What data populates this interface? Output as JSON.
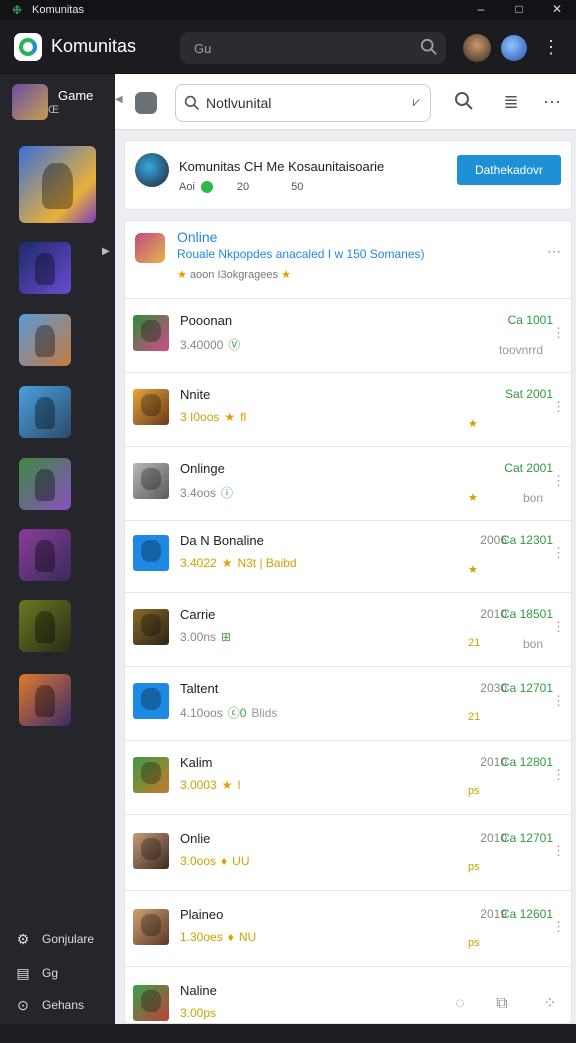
{
  "window": {
    "title": "Komunitas",
    "controls": [
      "–",
      "□",
      "✕"
    ]
  },
  "header": {
    "app_name": "Komunitas",
    "search_value": "Gu"
  },
  "sidebar": {
    "game": {
      "label": "Game",
      "sub": "Œ"
    },
    "bottom": [
      {
        "label": "Gonjulare",
        "icon": "gear-icon"
      },
      {
        "label": "Gg",
        "icon": "document-icon"
      },
      {
        "label": "Gehans",
        "icon": "compass-icon"
      }
    ]
  },
  "main": {
    "search_value": "Notlvunital",
    "feature": {
      "title": "Komunitas CH Me Kosaunitaisoarie",
      "meta_left": "Aoi",
      "meta_mid": "20",
      "meta_right": "50",
      "cta": "Dathekadovr"
    },
    "group": {
      "title": "Online",
      "subtitle": "Rouale Nkpopdes anacaled I w 150 Somanes)",
      "meta": "aoon I3okgragees"
    },
    "rows": [
      {
        "name": "Pooonan",
        "num": "3.40000",
        "badge": "Ⓥ",
        "year": "",
        "value": "Ca 1001",
        "note": "toovnrrd",
        "star": "",
        "gold": false,
        "extra": ""
      },
      {
        "name": "Nnite",
        "num": "3 I0oos",
        "badge": "★",
        "year": "",
        "value": "Sat 2001",
        "note": "",
        "star": "★",
        "gold": true,
        "extra": "fl"
      },
      {
        "name": "Onlinge",
        "num": "3.4oos",
        "badge": "ⓘ",
        "year": "",
        "value": "Cat 2001",
        "note": "bon",
        "star": "★",
        "gold": false,
        "extra": ""
      },
      {
        "name": "Da N Bonaline",
        "num": "3.4022",
        "badge": "★",
        "year": "2006",
        "value": "Ca 12301",
        "note": "",
        "star": "★",
        "gold": true,
        "extra": "N3t | Baibd"
      },
      {
        "name": "Carrie",
        "num": "3.00ns",
        "badge": "⊞",
        "year": "2010",
        "value": "Ca 18501",
        "note": "bon",
        "star": "21",
        "gold": false,
        "extra": ""
      },
      {
        "name": "Taltent",
        "num": "4.10oos",
        "badge": "ⓒ0",
        "year": "2030",
        "value": "Ca 12701",
        "note": "",
        "star": "21",
        "gold": false,
        "extra": "Blids"
      },
      {
        "name": "Kalim",
        "num": "3.0003",
        "badge": "★",
        "year": "2010",
        "value": "Ca 12801",
        "note": "",
        "star": "ps",
        "gold": true,
        "extra": "ǀ"
      },
      {
        "name": "Onlie",
        "num": "3.0oos",
        "badge": "♦",
        "year": "2010",
        "value": "Ca 12701",
        "note": "",
        "star": "ps",
        "gold": true,
        "extra": "UU"
      },
      {
        "name": "Plaineo",
        "num": "1.30oes",
        "badge": "♦",
        "year": "2019",
        "value": "Ca 12601",
        "note": "",
        "star": "ps",
        "gold": true,
        "extra": "NU"
      },
      {
        "name": "Naline",
        "num": "3.00ps",
        "badge": "",
        "year": "",
        "value": "",
        "note": "",
        "star": "",
        "gold": true,
        "extra": ""
      }
    ]
  },
  "colors": {
    "accent": "#1e88e5",
    "green": "#2eb84a",
    "sidebar": "#24262b",
    "header": "#1b1c20"
  }
}
